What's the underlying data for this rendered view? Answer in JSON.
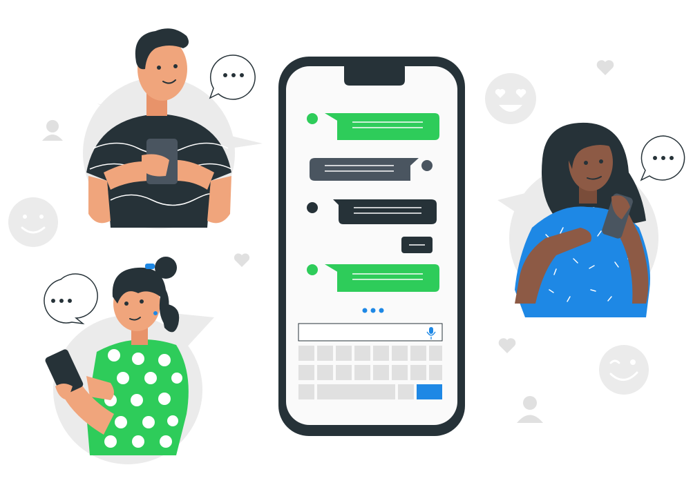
{
  "illustration": {
    "subject": "group-chat-on-smartphone",
    "icons": [
      "heart-icon",
      "smiley-icon",
      "heart-eyes-emoji-icon",
      "wink-emoji-icon",
      "user-icon",
      "ellipsis-speech-bubble-icon",
      "microphone-icon"
    ]
  },
  "phone": {
    "messages": [
      {
        "side": "right",
        "color": "#2ecc5a"
      },
      {
        "side": "left",
        "color": "#4a5560"
      },
      {
        "side": "right",
        "color": "#263238"
      },
      {
        "side": "left",
        "color": "#263238"
      },
      {
        "side": "right",
        "color": "#2ecc5a"
      }
    ],
    "typing_indicator_color": "#1e88e5",
    "send_key_color": "#1e88e5"
  },
  "colors": {
    "green": "#2ecc5a",
    "dark": "#263238",
    "blue": "#1e88e5",
    "light_gray": "#ebebeb",
    "skin_light": "#f0a57c",
    "skin_dark": "#8d5a45"
  }
}
